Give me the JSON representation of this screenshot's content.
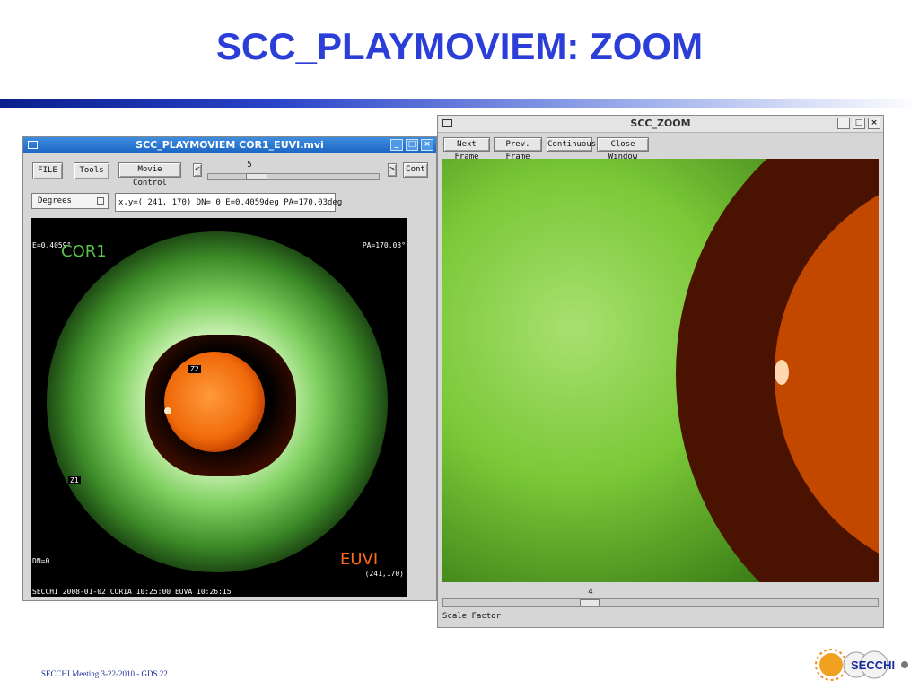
{
  "slide": {
    "title": "SCC_PLAYMOVIEM: ZOOM",
    "footer": "SECCHI Meeting  3-22-2010  - GDS 22",
    "logo_text": "SECCHI"
  },
  "left_window": {
    "title": "SCC_PLAYMOVIEM  COR1_EUVI.mvi",
    "file_label": "FILE",
    "tools_label": "Tools",
    "movie_control_label": "Movie Control",
    "prev_arrow": "<",
    "next_arrow": ">",
    "cont_label": "Cont",
    "frame_value": "5",
    "frame_fraction": 0.25,
    "units_select": "Degrees",
    "readout": "x,y=( 241, 170) DN=  0 E=0.4059deg PA=170.03deg",
    "display": {
      "elong_label": "E=0.4059°",
      "pa_label": "PA=170.03°",
      "cor1_label": "COR1",
      "euvi_label": "EUVI",
      "coords_label": "(241,170)",
      "dn_label": "DN=0",
      "info_line": "SECCHI  2008-01-02  COR1A 10:25:00  EUVA 10:26:15",
      "z1_label": "Z1",
      "z2_label": "Z2"
    }
  },
  "right_window": {
    "title": "SCC_ZOOM",
    "next_frame_label": "Next Frame",
    "prev_frame_label": "Prev. Frame",
    "continuous_label": "Continuous",
    "close_window_label": "Close Window",
    "scale_value": "4",
    "scale_fraction": 0.33,
    "scale_label": "Scale Factor"
  },
  "colors": {
    "title_blue": "#2b3fd8",
    "cor1_green": "#58c24a",
    "euvi_orange": "#ff6a1a",
    "sun_orange": "#f06a0a"
  },
  "icons": {
    "minimize": "minimize-icon",
    "maximize": "maximize-icon",
    "close": "close-icon",
    "window_menu": "window-menu-icon"
  }
}
